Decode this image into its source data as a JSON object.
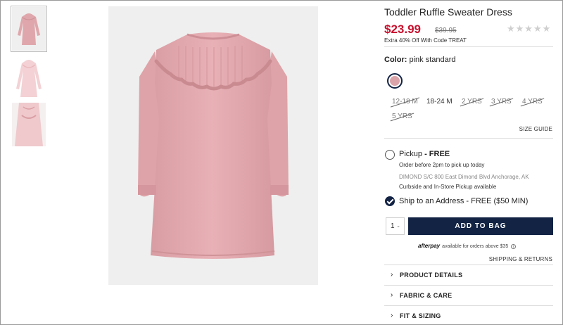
{
  "product": {
    "title": "Toddler Ruffle Sweater Dress",
    "price": "$23.99",
    "original_price": "$39.95",
    "rating_stars": "★★★★★",
    "promo": "Extra 40% Off With Code TREAT"
  },
  "color": {
    "label": "Color:",
    "value": "pink standard",
    "swatch_color": "#dba4aa"
  },
  "sizes": [
    {
      "label": "12-18 M",
      "available": false
    },
    {
      "label": "18-24 M",
      "available": true
    },
    {
      "label": "2 YRS",
      "available": false
    },
    {
      "label": "3 YRS",
      "available": false
    },
    {
      "label": "4 YRS",
      "available": false
    },
    {
      "label": "5 YRS",
      "available": false
    }
  ],
  "size_guide": "SIZE GUIDE",
  "pickup": {
    "title": "Pickup",
    "suffix": " - FREE",
    "note": "Order before 2pm to pick up today",
    "store": "DIMOND S/C 800 East Dimond Blvd Anchorage, AK",
    "options": "Curbside and In-Store Pickup available"
  },
  "ship": {
    "label": "Ship to an Address - FREE ($50 MIN)"
  },
  "quantity": "1",
  "add_to_bag": "ADD TO BAG",
  "afterpay": {
    "logo": "afterpay",
    "text": "available for orders above $35",
    "info": "i"
  },
  "shipping_returns": "SHIPPING & RETURNS",
  "accordion": [
    {
      "label": "PRODUCT DETAILS"
    },
    {
      "label": "FABRIC & CARE"
    },
    {
      "label": "FIT & SIZING"
    }
  ],
  "colors": {
    "accent_navy": "#122344",
    "price_red": "#c8102e",
    "dress_pink": "#e3a9ae"
  }
}
